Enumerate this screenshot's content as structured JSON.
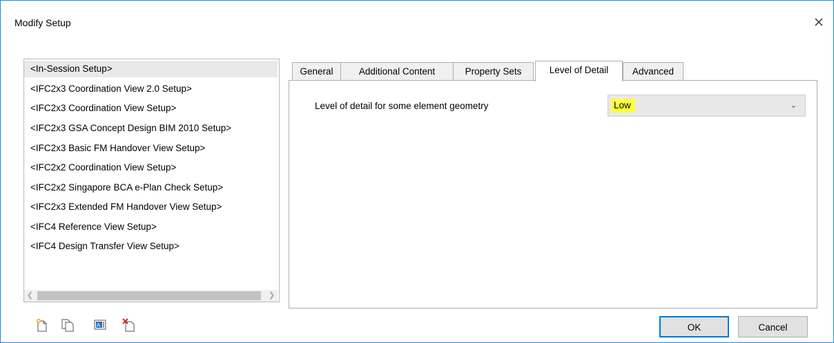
{
  "window": {
    "title": "Modify Setup"
  },
  "setups": [
    "<In-Session Setup>",
    "<IFC2x3 Coordination View 2.0 Setup>",
    "<IFC2x3 Coordination View Setup>",
    "<IFC2x3 GSA Concept Design BIM 2010 Setup>",
    "<IFC2x3 Basic FM Handover View Setup>",
    "<IFC2x2 Coordination View Setup>",
    "<IFC2x2 Singapore BCA e-Plan Check Setup>",
    "<IFC2x3 Extended FM Handover View Setup>",
    "<IFC4 Reference View Setup>",
    "<IFC4 Design Transfer View Setup>"
  ],
  "selected_setup": "<In-Session Setup>",
  "tabs": [
    "General",
    "Additional Content",
    "Property Sets",
    "Level of Detail",
    "Advanced"
  ],
  "active_tab": "Level of Detail",
  "level_of_detail": {
    "label": "Level of detail for some element geometry",
    "value": "Low",
    "highlight_color": "#ffff40"
  },
  "toolbar_icons": [
    "new-setup-icon",
    "duplicate-setup-icon",
    "rename-setup-icon",
    "delete-setup-icon"
  ],
  "buttons": {
    "ok": "OK",
    "cancel": "Cancel"
  },
  "colors": {
    "window_border": "#1a8ad4",
    "selected_item": "#e9e9e9",
    "default_button_border": "#0078d7"
  }
}
